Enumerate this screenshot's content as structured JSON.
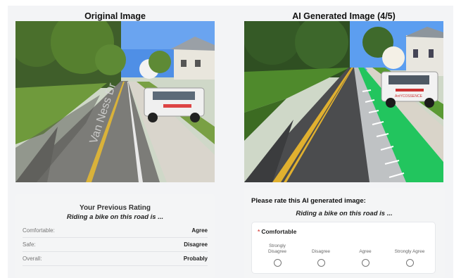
{
  "left_column": {
    "title": "Original Image",
    "street_text": "Van Ness Dr"
  },
  "right_column": {
    "title": "AI Generated Image (4/5)",
    "truck_text": "AntYCOSSENCE"
  },
  "previous_rating": {
    "title": "Your Previous Rating",
    "subtitle": "Riding a bike on this road is ...",
    "rows": [
      {
        "key": "Comfortable:",
        "value": "Agree"
      },
      {
        "key": "Safe:",
        "value": "Disagree"
      },
      {
        "key": "Overall:",
        "value": "Probably"
      }
    ]
  },
  "rate_panel": {
    "title": "Please rate this AI generated image:",
    "subtitle": "Riding a bike on this road is ...",
    "question": {
      "required_mark": "*",
      "label": "Comfortable",
      "options": [
        "Strongly Disagree",
        "Disagree",
        "Agree",
        "Strongly Agree"
      ]
    }
  },
  "colors": {
    "bike_lane": "#22c55e",
    "required": "#d9534f"
  }
}
